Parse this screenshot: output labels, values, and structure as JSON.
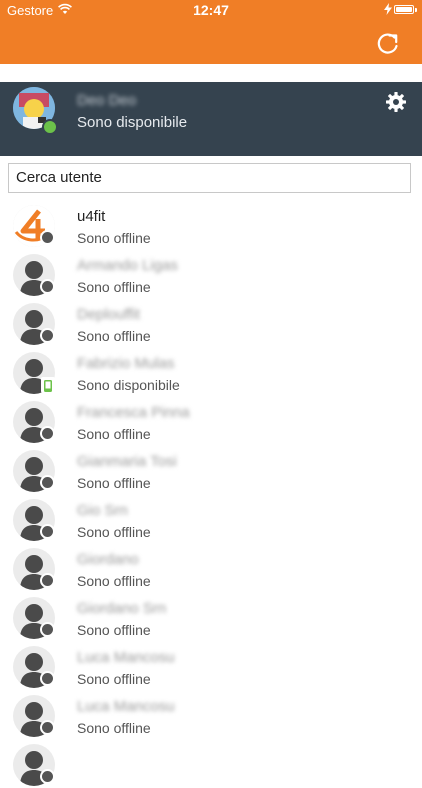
{
  "status_bar": {
    "carrier": "Gestore",
    "time": "12:47"
  },
  "colors": {
    "accent": "#f07e26",
    "profile_bg": "#35434f",
    "online": "#6cc24a",
    "offline": "#555555",
    "mobile": "#6cc24a"
  },
  "profile": {
    "name": "Deo Deo",
    "status": "Sono disponibile"
  },
  "search": {
    "placeholder": "Cerca utente"
  },
  "contacts": [
    {
      "name": "u4fit",
      "status": "Sono offline"
    },
    {
      "name": "Armando Ligas",
      "status": "Sono offline"
    },
    {
      "name": "Deplouffit",
      "status": "Sono offline"
    },
    {
      "name": "Fabrizio Mulas",
      "status": "Sono disponibile"
    },
    {
      "name": "Francesca Pinna",
      "status": "Sono offline"
    },
    {
      "name": "Gianmaria Tosi",
      "status": "Sono offline"
    },
    {
      "name": "Gio Srn",
      "status": "Sono offline"
    },
    {
      "name": "Giordano",
      "status": "Sono offline"
    },
    {
      "name": "Giordano Srn",
      "status": "Sono offline"
    },
    {
      "name": "Luca Mancosu",
      "status": "Sono offline"
    },
    {
      "name": "Luca Mancosu",
      "status": "Sono offline"
    },
    {
      "name": "",
      "status": ""
    }
  ]
}
